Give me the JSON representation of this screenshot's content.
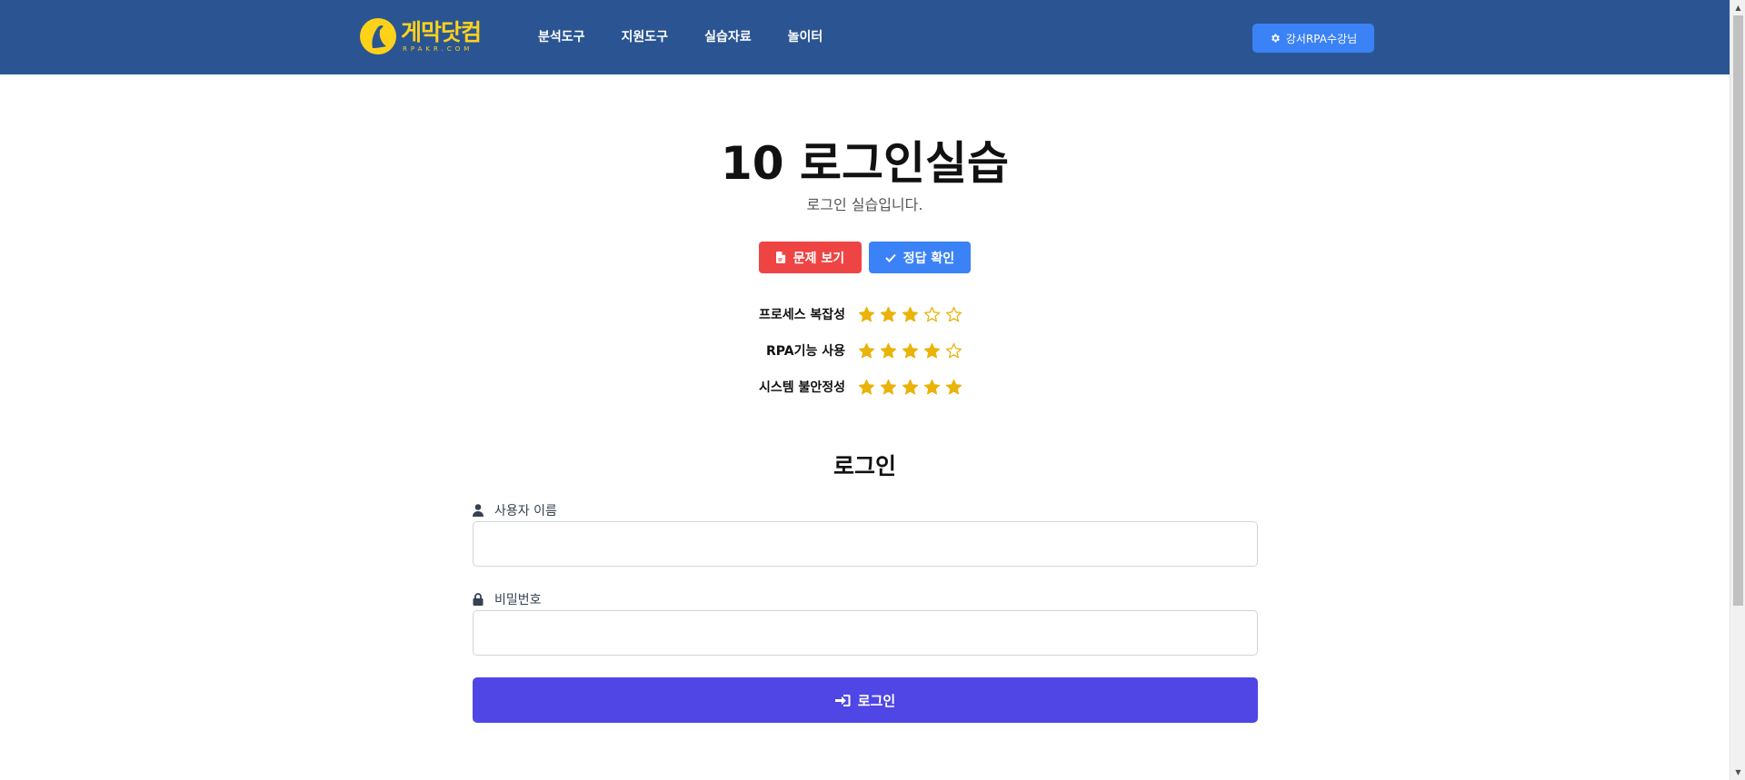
{
  "colors": {
    "header_bg": "#2b5592",
    "logo_yellow": "#ffd21a",
    "accent_blue": "#3b82f6",
    "danger_red": "#ef4444",
    "primary_indigo": "#4f46e5",
    "star_gold": "#eab308"
  },
  "header": {
    "logo": {
      "main": "게막닷컴",
      "sub": "RPAKR.COM",
      "icon": "logo-mark-icon"
    },
    "nav": [
      {
        "label": "분석도구"
      },
      {
        "label": "지원도구"
      },
      {
        "label": "실습자료"
      },
      {
        "label": "놀이터"
      }
    ],
    "user_button": {
      "label": "강서RPA수강님",
      "icon": "gear-icon"
    }
  },
  "main": {
    "title": "10 로그인실습",
    "subtitle": "로그인 실습입니다.",
    "buttons": {
      "view_problem": {
        "label": "문제 보기",
        "icon": "document-icon"
      },
      "check_answer": {
        "label": "정답 확인",
        "icon": "check-icon"
      }
    },
    "ratings": [
      {
        "label": "프로세스 복잡성",
        "value": 3,
        "max": 5
      },
      {
        "label": "RPA기능 사용",
        "value": 4,
        "max": 5
      },
      {
        "label": "시스템 불안정성",
        "value": 5,
        "max": 5
      }
    ]
  },
  "login": {
    "heading": "로그인",
    "username_label": "사용자 이름",
    "username_value": "",
    "password_label": "비밀번호",
    "password_value": "",
    "submit_label": "로그인"
  }
}
